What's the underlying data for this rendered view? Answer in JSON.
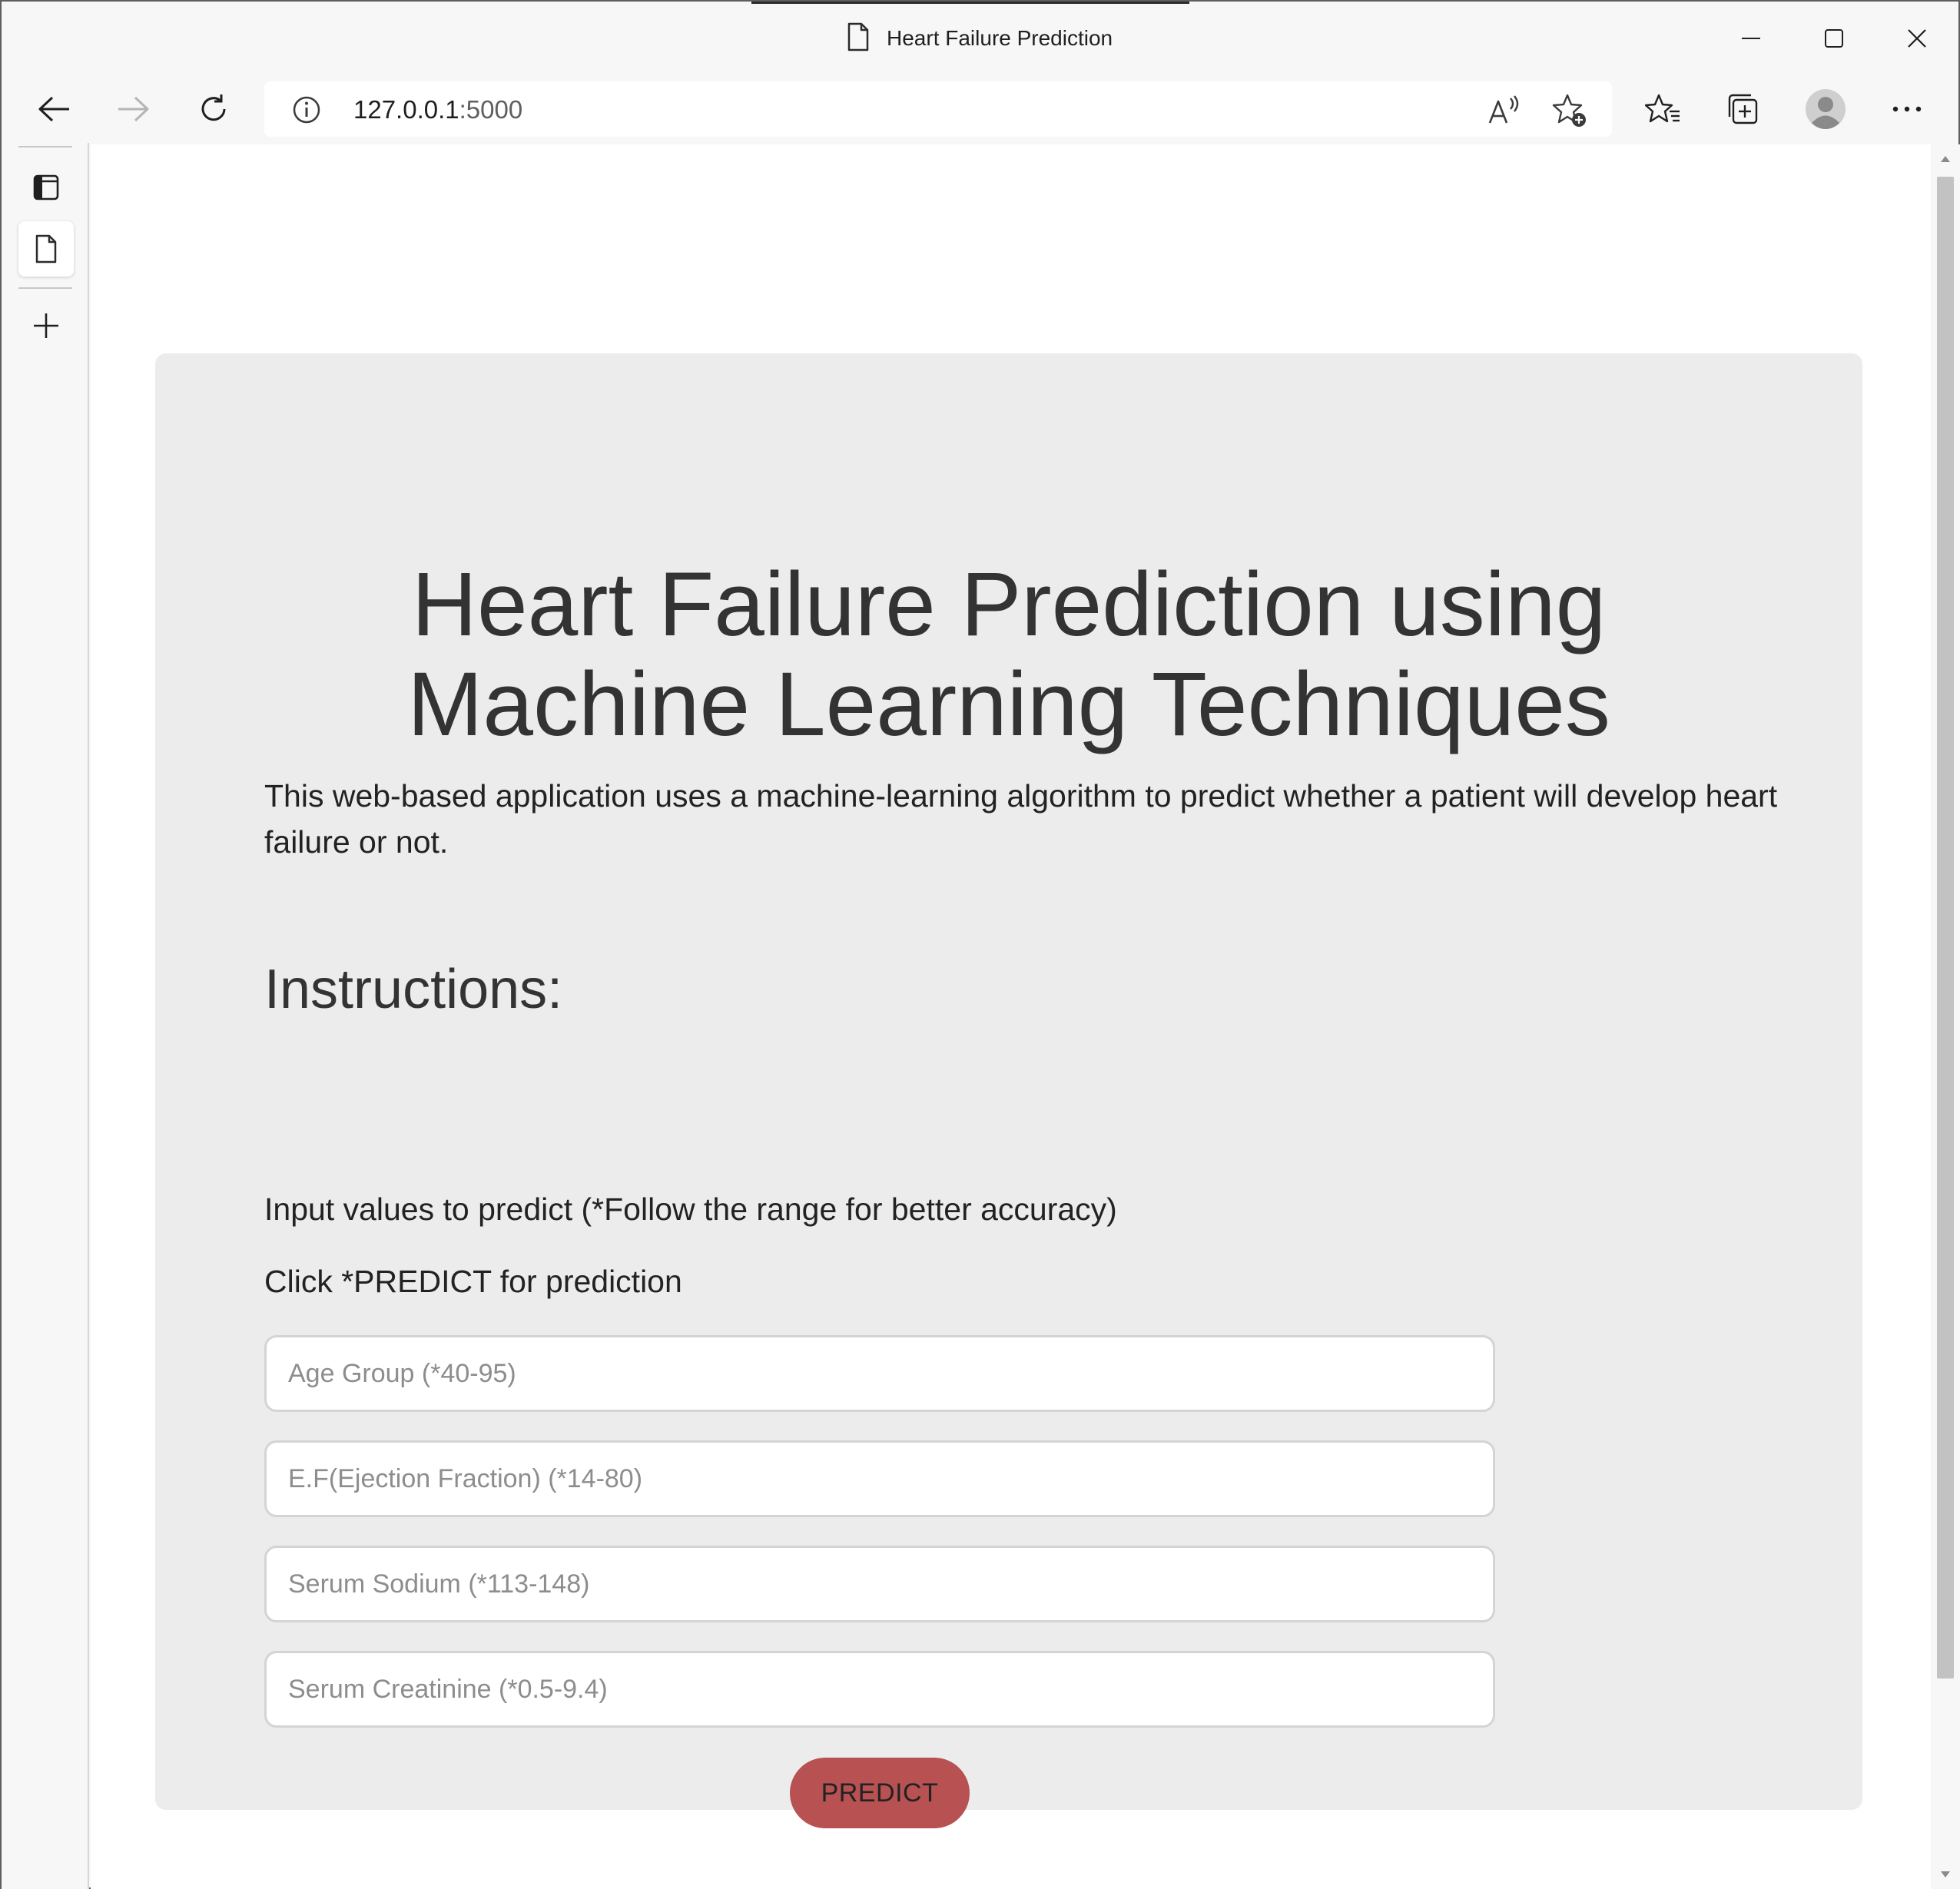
{
  "window": {
    "title": "Heart Failure Prediction"
  },
  "toolbar": {
    "address_host": "127.0.0.1",
    "address_port": ":5000"
  },
  "page": {
    "heading_line1": "Heart Failure Prediction using",
    "heading_line2": "Machine Learning Techniques",
    "description": "This web-based application uses a machine-learning algorithm to predict whether a patient will develop heart failure or not.",
    "instructions_title": "Instructions:",
    "instruction_1": "Input values to predict (*Follow the range for better accuracy)",
    "instruction_2": "Click *PREDICT for prediction",
    "fields": [
      {
        "placeholder": "Age Group (*40-95)",
        "value": ""
      },
      {
        "placeholder": "E.F(Ejection Fraction) (*14-80)",
        "value": ""
      },
      {
        "placeholder": "Serum Sodium (*113-148)",
        "value": ""
      },
      {
        "placeholder": "Serum Creatinine (*0.5-9.4)",
        "value": ""
      }
    ],
    "predict_label": "PREDICT"
  },
  "colors": {
    "card_background": "#ececec",
    "predict_button": "#b85152",
    "heading_text": "#333333"
  },
  "icons": {
    "title": "page-icon",
    "back": "back-arrow-icon",
    "forward": "forward-arrow-icon",
    "refresh": "refresh-icon",
    "site_info": "info-icon",
    "read_aloud": "read-aloud-icon",
    "add_favorite": "add-favorite-icon",
    "favorites": "favorites-icon",
    "collections": "collections-icon",
    "profile": "profile-avatar-icon",
    "more": "more-options-icon",
    "tab_actions": "tab-actions-icon",
    "tab_page": "page-icon",
    "new_tab": "plus-icon"
  }
}
